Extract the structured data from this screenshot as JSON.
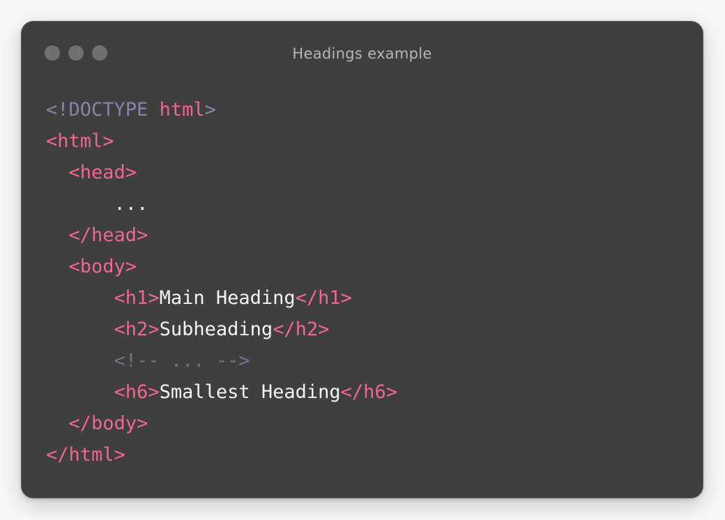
{
  "window": {
    "title": "Headings example"
  },
  "colors": {
    "window_bg": "#3f3f3f",
    "tag": "#f2668b",
    "doctype": "#8b83a6",
    "text": "#f5f5f5",
    "comment": "#75718a"
  },
  "code": {
    "lines": [
      {
        "indent": "",
        "tokens": [
          {
            "type": "doctype",
            "text": "<!DOCTYPE "
          },
          {
            "type": "tag",
            "text": "html"
          },
          {
            "type": "doctype",
            "text": ">"
          }
        ]
      },
      {
        "indent": "",
        "tokens": [
          {
            "type": "tag",
            "text": "<html>"
          }
        ]
      },
      {
        "indent": "  ",
        "tokens": [
          {
            "type": "tag",
            "text": "<head>"
          }
        ]
      },
      {
        "indent": "      ",
        "tokens": [
          {
            "type": "text",
            "text": "..."
          }
        ]
      },
      {
        "indent": "  ",
        "tokens": [
          {
            "type": "tag",
            "text": "</head>"
          }
        ]
      },
      {
        "indent": "  ",
        "tokens": [
          {
            "type": "tag",
            "text": "<body>"
          }
        ]
      },
      {
        "indent": "      ",
        "tokens": [
          {
            "type": "tag",
            "text": "<h1>"
          },
          {
            "type": "text",
            "text": "Main Heading"
          },
          {
            "type": "tag",
            "text": "</h1>"
          }
        ]
      },
      {
        "indent": "      ",
        "tokens": [
          {
            "type": "tag",
            "text": "<h2>"
          },
          {
            "type": "text",
            "text": "Subheading"
          },
          {
            "type": "tag",
            "text": "</h2>"
          }
        ]
      },
      {
        "indent": "      ",
        "tokens": [
          {
            "type": "comment",
            "text": "<!-- ... -->"
          }
        ]
      },
      {
        "indent": "      ",
        "tokens": [
          {
            "type": "tag",
            "text": "<h6>"
          },
          {
            "type": "text",
            "text": "Smallest Heading"
          },
          {
            "type": "tag",
            "text": "</h6>"
          }
        ]
      },
      {
        "indent": "  ",
        "tokens": [
          {
            "type": "tag",
            "text": "</body>"
          }
        ]
      },
      {
        "indent": "",
        "tokens": [
          {
            "type": "tag",
            "text": "</html>"
          }
        ]
      }
    ]
  }
}
